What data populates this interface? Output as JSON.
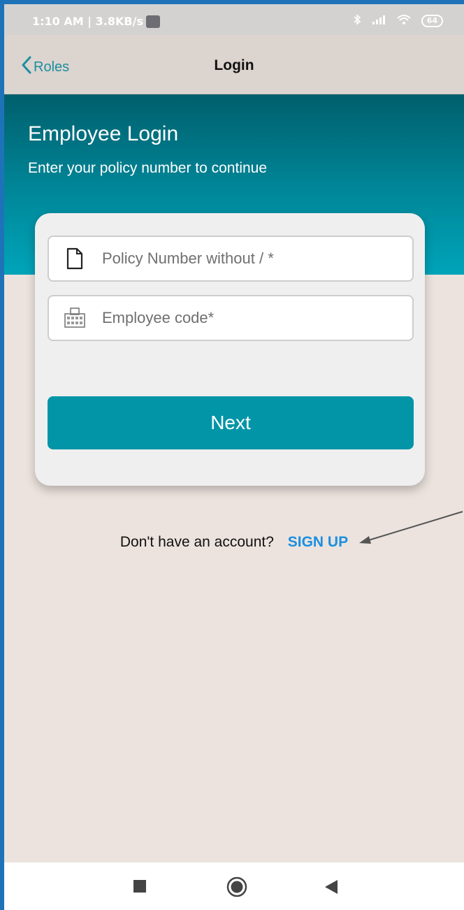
{
  "status_bar": {
    "time_speed": "1:10 AM | 3.8KB/s",
    "battery": "64"
  },
  "nav": {
    "back_label": "Roles",
    "title": "Login"
  },
  "hero": {
    "title": "Employee Login",
    "subtitle": "Enter your policy number to continue"
  },
  "form": {
    "policy_placeholder": "Policy Number without / *",
    "employee_placeholder": "Employee code*",
    "next_label": "Next"
  },
  "signup": {
    "prompt": "Don't have an account?",
    "link": "SIGN UP"
  },
  "colors": {
    "accent": "#0295a7",
    "link": "#1a8fe0",
    "background": "#ece3de"
  },
  "icons": {
    "policy_field": "document-icon",
    "employee_field": "id-badge-icon",
    "back": "chevron-left-icon"
  }
}
